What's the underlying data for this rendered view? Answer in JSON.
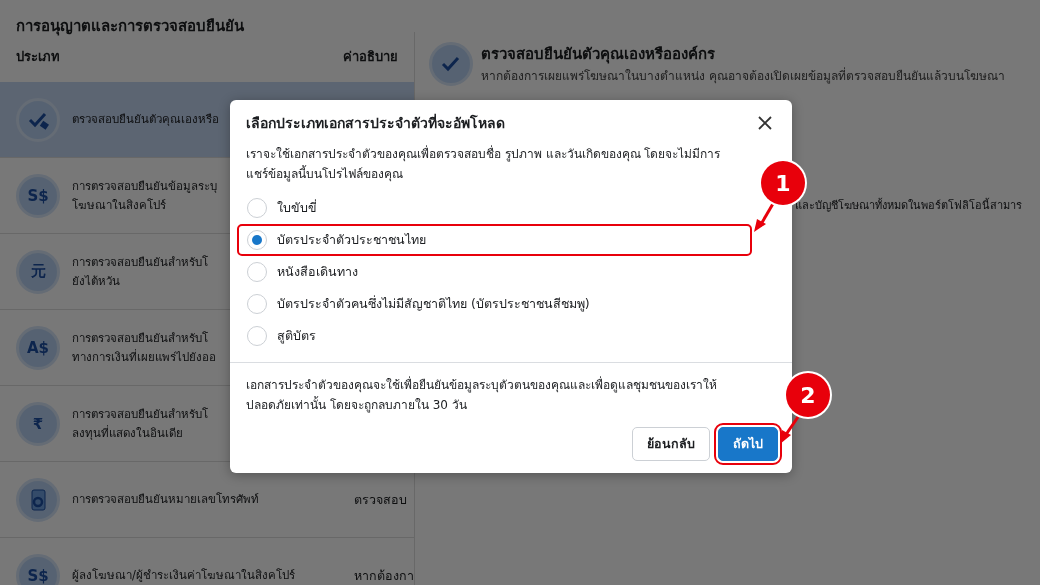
{
  "page_title": "การอนุญาตและการตรวจสอบยืนยัน",
  "table": {
    "columns": [
      "ประเภท",
      "ค่าอธิบาย"
    ],
    "rows": [
      {
        "icon": {
          "kind": "check"
        },
        "name": [
          "ตรวจสอบยืนยันตัวคุณเองหรือ"
        ],
        "selected": true
      },
      {
        "icon": {
          "kind": "glyph",
          "text": "S$"
        },
        "name": [
          "การตรวจสอบยืนยันข้อมูลระบุ",
          "โฆษณาในสิงคโปร์"
        ],
        "selected": false
      },
      {
        "icon": {
          "kind": "glyph",
          "text": "元"
        },
        "name": [
          "การตรวจสอบยืนยันสำหรับโ",
          "ยังไต้หวัน"
        ],
        "selected": false
      },
      {
        "icon": {
          "kind": "glyph",
          "text": "A$"
        },
        "name": [
          "การตรวจสอบยืนยันสำหรับโ",
          "ทางการเงินที่เผยแพร่ไปยังออ"
        ],
        "selected": false
      },
      {
        "icon": {
          "kind": "glyph",
          "text": "₹"
        },
        "name": [
          "การตรวจสอบยืนยันสำหรับโ",
          "ลงทุนที่แสดงในอินเดีย"
        ],
        "selected": false
      },
      {
        "icon": {
          "kind": "phone"
        },
        "name": [
          "การตรวจสอบยืนยันหมายเลขโทรศัพท์"
        ],
        "description": "ตรวจสอบ",
        "selected": false
      },
      {
        "icon": {
          "kind": "glyph",
          "text": "S$"
        },
        "name": [
          "ผู้ลงโฆษณา/ผู้ชำระเงินค่าโฆษณาในสิงคโปร์"
        ],
        "description": "หากต้องกา",
        "selected": false
      }
    ]
  },
  "detail": {
    "title": "ตรวจสอบยืนยันตัวคุณเองหรือองค์กร",
    "subtitle": "หากต้องการเผยแพร่โฆษณาในบางตำแหน่ง คุณอาจต้องเปิดเผยข้อมูลที่ตรวจสอบยืนยันแล้วบนโฆษณา",
    "section_text": "และบัญชีโฆษณาทั้งหมดในพอร์ตโฟลิโอนี้สามาร"
  },
  "dialog": {
    "title": "เลือกประเภทเอกสารประจำตัวที่จะอัพโหลด",
    "description": "เราจะใช้เอกสารประจำตัวของคุณเพื่อตรวจสอบชื่อ รูปภาพ และวันเกิดของคุณ โดยจะไม่มีการแชร์ข้อมูลนี้บนโปรไฟล์ของคุณ",
    "options": [
      {
        "label": "ใบขับขี่",
        "selected": false,
        "highlighted": false
      },
      {
        "label": "บัตรประจำตัวประชาชนไทย",
        "selected": true,
        "highlighted": true
      },
      {
        "label": "หนังสือเดินทาง",
        "selected": false,
        "highlighted": false
      },
      {
        "label": "บัตรประจำตัวคนซึ่งไม่มีสัญชาติไทย (บัตรประชาชนสีชมพู)",
        "selected": false,
        "highlighted": false
      },
      {
        "label": "สูติบัตร",
        "selected": false,
        "highlighted": false
      }
    ],
    "note": "เอกสารประจำตัวของคุณจะใช้เพื่อยืนยันข้อมูลระบุตัวตนของคุณและเพื่อดูแลชุมชนของเราให้ปลอดภัยเท่านั้น โดยจะถูกลบภายใน 30 วัน",
    "buttons": [
      {
        "label": "ย้อนกลับ",
        "kind": "secondary",
        "highlighted": false
      },
      {
        "label": "ถัดไป",
        "kind": "primary",
        "highlighted": true
      }
    ]
  },
  "annotations": [
    {
      "number": "1"
    },
    {
      "number": "2"
    }
  ]
}
